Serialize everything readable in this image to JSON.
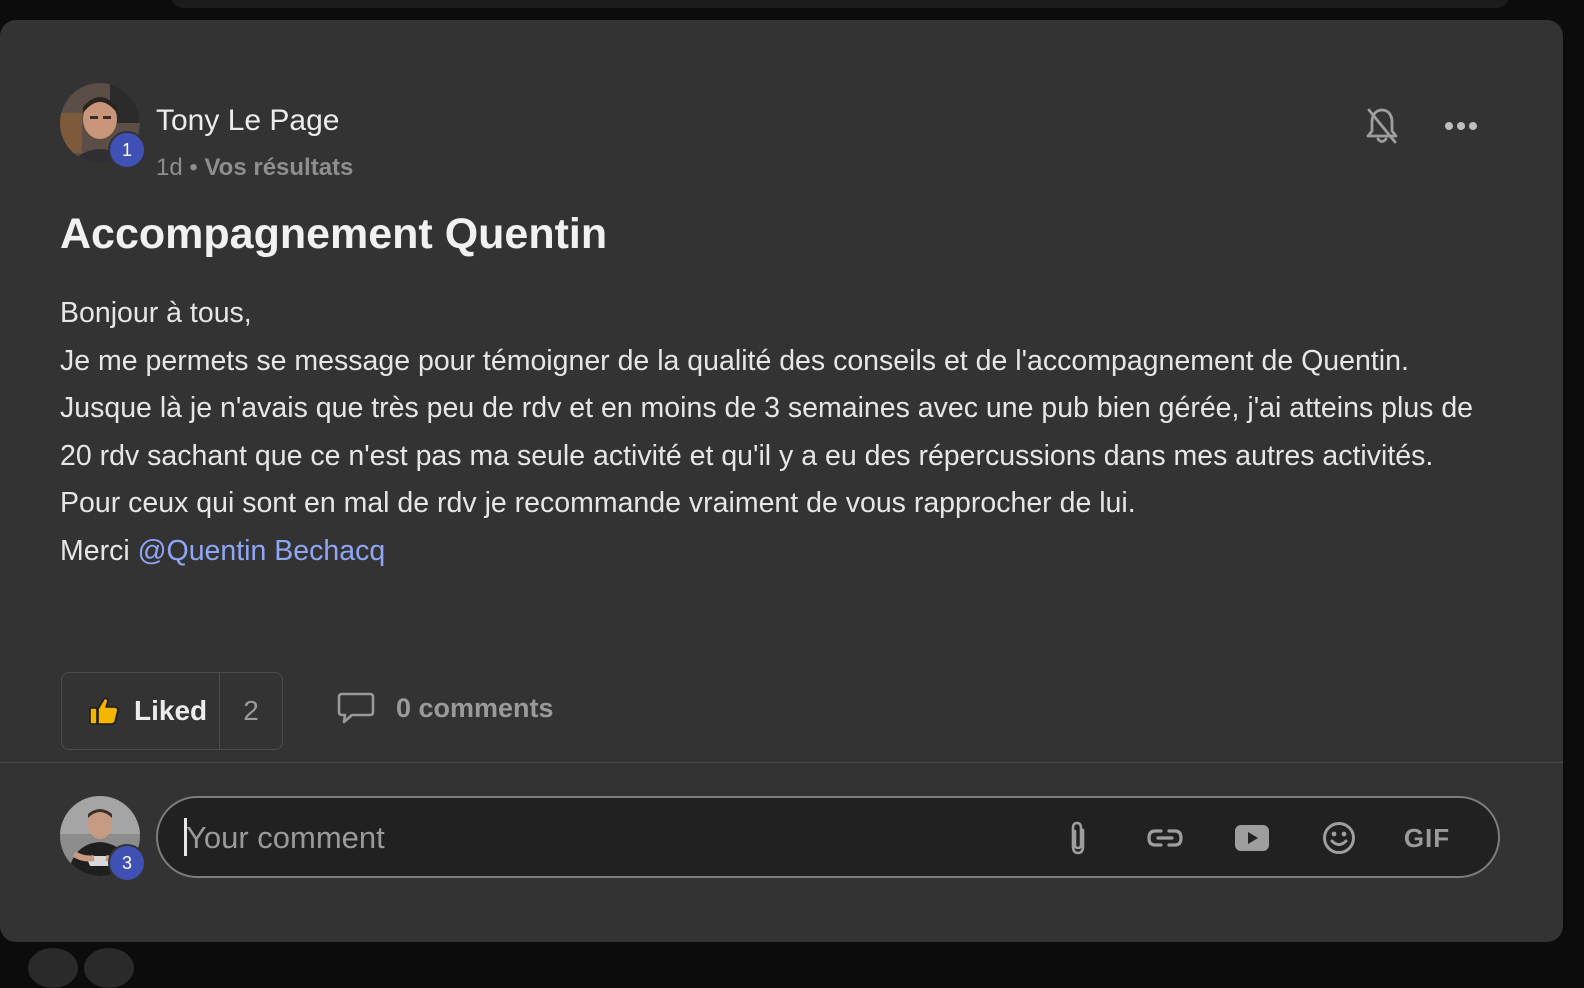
{
  "post": {
    "author": {
      "name": "Tony Le Page",
      "level": "1",
      "avatar_icon": "user-avatar-photo"
    },
    "time": "1d",
    "separator": "•",
    "category": "Vos résultats",
    "title": "Accompagnement Quentin",
    "body": {
      "line1": "Bonjour à tous,",
      "line2": "Je me permets se message pour témoigner de la qualité des conseils et de l'accompagnement de Quentin. Jusque là je n'avais que très peu de rdv et en moins de 3 semaines avec une pub bien gérée, j'ai atteins plus de 20 rdv sachant que ce n'est pas ma seule activité et qu'il y a eu des répercussions dans mes autres activités.",
      "line3": "Pour ceux qui sont en mal de rdv je recommande vraiment de vous rapprocher de lui.",
      "thanks": "Merci",
      "mention": "@Quentin Bechacq"
    },
    "actions": {
      "like_label": "Liked",
      "like_count": "2",
      "comments_label": "0 comments"
    },
    "icons": {
      "notify": "bell-off-icon",
      "more": "more-horizontal-icon",
      "like": "thumbs-up-icon",
      "comment": "comment-bubble-icon"
    }
  },
  "comment_composer": {
    "placeholder": "Your comment",
    "user_level": "3",
    "tools": {
      "attach": "paperclip-icon",
      "link": "link-icon",
      "video": "youtube-icon",
      "emoji": "smiley-icon",
      "gif": "GIF"
    }
  },
  "colors": {
    "background": "#0c0c0c",
    "card": "#333333",
    "accent_badge": "#3f51b5",
    "mention": "#8fa6f5",
    "like_yellow": "#f5b400"
  }
}
